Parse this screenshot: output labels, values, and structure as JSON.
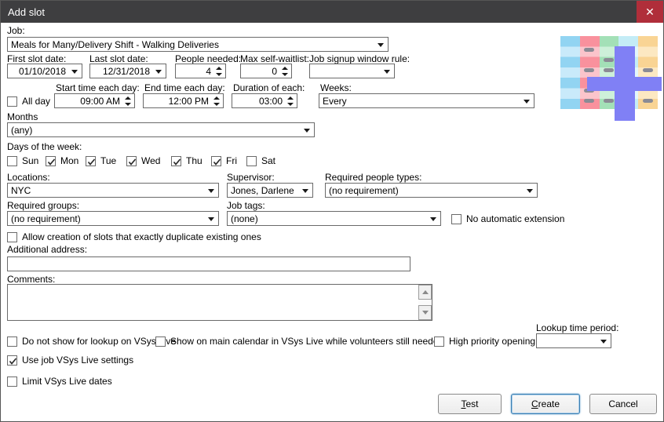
{
  "colors": {
    "titlebar-bg": "#3e3e40",
    "titlebar-text": "#ffffff",
    "close-bg": "#b02e3a",
    "dialog-bg": "#ffffff",
    "field-border": "#6a6a6a",
    "label-text": "#000000",
    "button-border": "#8a8a8a",
    "default-button-border": "#3c7fb1",
    "logo-plus": "#8080f5",
    "logo-col1a": "#92d4f2",
    "logo-col1b": "#c9eafa",
    "logo-col2a": "#f9919d",
    "logo-col2b": "#fbc4cb",
    "logo-col3a": "#a3e0b7",
    "logo-col3b": "#cdf0d9",
    "logo-col4a": "#c4ecf6",
    "logo-col4b": "#e2f6fb",
    "logo-col5a": "#f9d494",
    "logo-col5b": "#fce8c2",
    "logo-dash": "#8b8b95"
  },
  "titlebar": {
    "title": "Add slot",
    "close_icon": "✕"
  },
  "job": {
    "label": "Job:",
    "value": "Meals for Many/Delivery Shift - Walking Deliveries"
  },
  "dates_row": {
    "first_slot_date": {
      "label": "First slot date:",
      "value": "01/10/2018"
    },
    "last_slot_date": {
      "label": "Last slot date:",
      "value": "12/31/2018"
    },
    "people_needed": {
      "label": "People needed:",
      "value": "4"
    },
    "max_self_waitlist": {
      "label": "Max self-waitlist:",
      "value": "0"
    },
    "job_signup_window_rule": {
      "label": "Job signup window rule:",
      "value": ""
    }
  },
  "times_row": {
    "all_day": {
      "label": "All day",
      "checked": false
    },
    "start_time": {
      "label": "Start time each day:",
      "value": "09:00 AM"
    },
    "end_time": {
      "label": "End time each day:",
      "value": "12:00 PM"
    },
    "duration": {
      "label": "Duration of each:",
      "value": "03:00"
    },
    "weeks": {
      "label": "Weeks:",
      "value": "Every"
    }
  },
  "months": {
    "label": "Months",
    "value": "(any)"
  },
  "days_of_week": {
    "label": "Days of the week:",
    "items": [
      {
        "label": "Sun",
        "checked": false
      },
      {
        "label": "Mon",
        "checked": true
      },
      {
        "label": "Tue",
        "checked": true
      },
      {
        "label": "Wed",
        "checked": true
      },
      {
        "label": "Thu",
        "checked": true
      },
      {
        "label": "Fri",
        "checked": true
      },
      {
        "label": "Sat",
        "checked": false
      }
    ]
  },
  "locations_row": {
    "locations": {
      "label": "Locations:",
      "value": "NYC"
    },
    "supervisor": {
      "label": "Supervisor:",
      "value": "Jones, Darlene"
    },
    "required_people_types": {
      "label": "Required people types:",
      "value": "(no requirement)"
    }
  },
  "groups_row": {
    "required_groups": {
      "label": "Required groups:",
      "value": "(no requirement)"
    },
    "job_tags": {
      "label": "Job tags:",
      "value": "(none)"
    },
    "no_automatic_extension": {
      "label": "No automatic extension",
      "checked": false
    }
  },
  "allow_duplicates": {
    "label": "Allow creation of slots that exactly duplicate existing ones",
    "checked": false
  },
  "additional_address": {
    "label": "Additional address:",
    "value": ""
  },
  "comments": {
    "label": "Comments:",
    "value": ""
  },
  "vsys_live_row": {
    "do_not_show": {
      "label": "Do not show for lookup on VSys Live",
      "checked": false
    },
    "show_on_main_calendar": {
      "label": "Show on main calendar in VSys Live while volunteers still needed",
      "checked": false
    },
    "high_priority": {
      "label": "High priority opening",
      "checked": false
    },
    "lookup_time_period": {
      "label": "Lookup time period:",
      "value": ""
    }
  },
  "use_job_vsys_live_settings": {
    "label": "Use job VSys Live settings",
    "checked": true
  },
  "limit_vsys_live_dates": {
    "label": "Limit VSys Live dates",
    "checked": false
  },
  "buttons": {
    "test": {
      "key": "T",
      "rest": "est"
    },
    "create": {
      "key": "C",
      "rest": "reate"
    },
    "cancel": {
      "label": "Cancel"
    }
  }
}
